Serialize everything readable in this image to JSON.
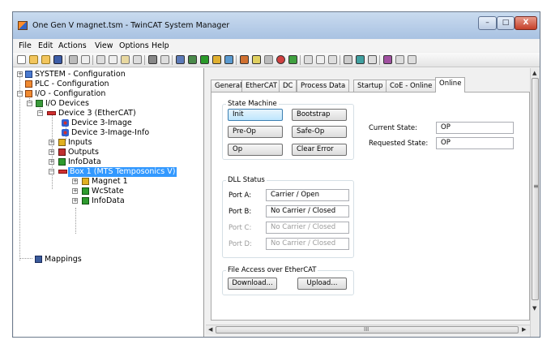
{
  "window": {
    "title": "One Gen V magnet.tsm - TwinCAT System Manager",
    "min_label": "–",
    "max_label": "□",
    "close_label": "X"
  },
  "menu": {
    "items": [
      "File",
      "Edit",
      "Actions",
      "View",
      "Options",
      "Help"
    ]
  },
  "tree": {
    "nodes": [
      {
        "label": "SYSTEM - Configuration",
        "icon": "system-config-icon"
      },
      {
        "label": "PLC - Configuration",
        "icon": "plc-config-icon"
      },
      {
        "label": "I/O - Configuration",
        "icon": "io-config-icon"
      },
      {
        "label": "I/O Devices",
        "icon": "io-devices-icon"
      },
      {
        "label": "Device 3 (EtherCAT)",
        "icon": "ethercat-device-icon"
      },
      {
        "label": "Device 3-Image",
        "icon": "image-icon"
      },
      {
        "label": "Device 3-Image-Info",
        "icon": "image-icon"
      },
      {
        "label": "Inputs",
        "icon": "inputs-icon"
      },
      {
        "label": "Outputs",
        "icon": "outputs-icon"
      },
      {
        "label": "InfoData",
        "icon": "infodata-icon"
      },
      {
        "label": "Box 1 (MTS Temposonics V)",
        "icon": "box-icon",
        "selected": true
      },
      {
        "label": "Magnet 1",
        "icon": "inputs-icon"
      },
      {
        "label": "WcState",
        "icon": "infodata-icon"
      },
      {
        "label": "InfoData",
        "icon": "infodata-icon"
      },
      {
        "label": "Mappings",
        "icon": "mappings-icon"
      }
    ]
  },
  "tabs": {
    "items": [
      "General",
      "EtherCAT",
      "DC",
      "Process Data",
      "Startup",
      "CoE - Online",
      "Online"
    ],
    "active": "Online"
  },
  "online": {
    "state_machine": {
      "title": "State Machine",
      "buttons": [
        "Init",
        "Bootstrap",
        "Pre-Op",
        "Safe-Op",
        "Op",
        "Clear Error"
      ]
    },
    "current_state_label": "Current State:",
    "current_state_value": "OP",
    "requested_state_label": "Requested State:",
    "requested_state_value": "OP",
    "dll_status": {
      "title": "DLL Status",
      "ports": [
        {
          "label": "Port A:",
          "value": "Carrier / Open",
          "enabled": true
        },
        {
          "label": "Port B:",
          "value": "No Carrier / Closed",
          "enabled": true
        },
        {
          "label": "Port C:",
          "value": "No Carrier / Closed",
          "enabled": false
        },
        {
          "label": "Port D:",
          "value": "No Carrier / Closed",
          "enabled": false
        }
      ]
    },
    "file_access": {
      "title": "File Access over EtherCAT",
      "download_label": "Download...",
      "upload_label": "Upload..."
    }
  },
  "scroll": {
    "h_grip": "III",
    "v_grip": "≡"
  }
}
